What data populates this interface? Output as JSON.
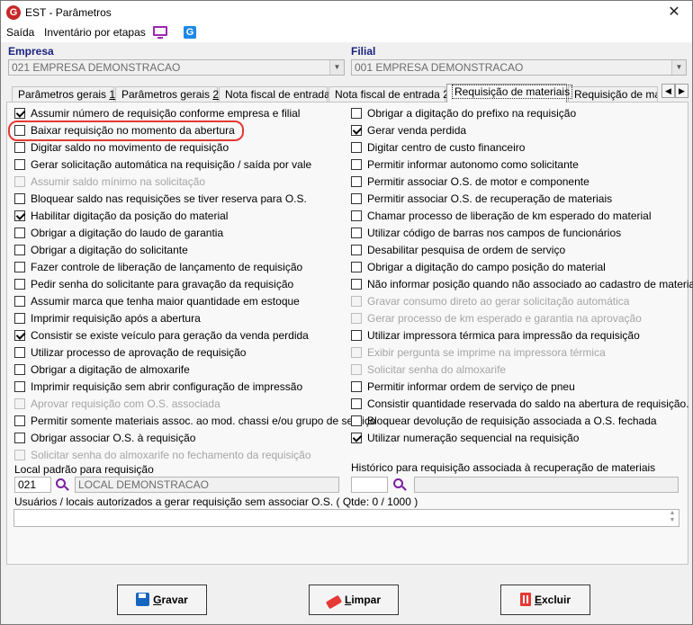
{
  "window": {
    "title": "EST - Parâmetros",
    "app_logo": "G",
    "close": "✕"
  },
  "menu": {
    "items": [
      "Saída",
      "Inventário por etapas"
    ],
    "icon_tv": "monitor-icon",
    "icon_g": "G"
  },
  "empresa": {
    "label": "Empresa",
    "value": "021 EMPRESA DEMONSTRACAO"
  },
  "filial": {
    "label": "Filial",
    "value": "001 EMPRESA DEMONSTRACAO"
  },
  "tabs": [
    {
      "pre": "Parâmetros gerais ",
      "key": "1",
      "post": ""
    },
    {
      "pre": "Parâmetros gerais ",
      "key": "2",
      "post": ""
    },
    {
      "pre": "Nota fiscal de entrada",
      "key": "",
      "post": ""
    },
    {
      "pre": "Nota fiscal de entrada 2",
      "key": "",
      "post": ""
    },
    {
      "pre": "Requisição de materiais",
      "key": "",
      "post": ""
    },
    {
      "pre": "Requisição de materi",
      "key": "",
      "post": ""
    }
  ],
  "left_options": [
    {
      "label": "Assumir número de requisição conforme empresa e filial",
      "checked": true,
      "enabled": true
    },
    {
      "label": "Baixar requisição no momento da abertura",
      "checked": false,
      "enabled": true
    },
    {
      "label": "Digitar saldo no movimento de requisição",
      "checked": false,
      "enabled": true
    },
    {
      "label": "Gerar solicitação automática na requisição / saída por vale",
      "checked": false,
      "enabled": true
    },
    {
      "label": "Assumir saldo mínimo na solicitação",
      "checked": false,
      "enabled": false
    },
    {
      "label": "Bloquear saldo nas requisições se tiver reserva para O.S.",
      "checked": false,
      "enabled": true
    },
    {
      "label": "Habilitar digitação da posição do material",
      "checked": true,
      "enabled": true
    },
    {
      "label": "Obrigar a digitação do laudo de garantia",
      "checked": false,
      "enabled": true
    },
    {
      "label": "Obrigar a digitação do solicitante",
      "checked": false,
      "enabled": true
    },
    {
      "label": "Fazer controle de liberação de lançamento de requisição",
      "checked": false,
      "enabled": true
    },
    {
      "label": "Pedir senha do solicitante para gravação da requisição",
      "checked": false,
      "enabled": true
    },
    {
      "label": "Assumir marca que tenha maior quantidade em estoque",
      "checked": false,
      "enabled": true
    },
    {
      "label": "Imprimir requisição após a abertura",
      "checked": false,
      "enabled": true
    },
    {
      "label": "Consistir se existe veículo para geração da venda perdida",
      "checked": true,
      "enabled": true
    },
    {
      "label": "Utilizar processo de aprovação de requisição",
      "checked": false,
      "enabled": true
    },
    {
      "label": "Obrigar a digitação de almoxarife",
      "checked": false,
      "enabled": true
    },
    {
      "label": "Imprimir requisição sem abrir configuração de impressão",
      "checked": false,
      "enabled": true
    },
    {
      "label": "Aprovar requisição com O.S. associada",
      "checked": false,
      "enabled": false
    },
    {
      "label": "Permitir somente materiais assoc. ao mod. chassi e/ou grupo de serviço",
      "checked": false,
      "enabled": true
    },
    {
      "label": "Obrigar associar O.S. à requisição",
      "checked": false,
      "enabled": true
    },
    {
      "label": "Solicitar senha do almoxarife no fechamento da requisição",
      "checked": false,
      "enabled": false
    }
  ],
  "right_options": [
    {
      "label": "Obrigar a digitação do prefixo na requisição",
      "checked": false,
      "enabled": true
    },
    {
      "label": "Gerar venda perdida",
      "checked": true,
      "enabled": true
    },
    {
      "label": "Digitar centro de custo financeiro",
      "checked": false,
      "enabled": true
    },
    {
      "label": "Permitir informar autonomo como solicitante",
      "checked": false,
      "enabled": true
    },
    {
      "label": "Permitir associar O.S. de motor e componente",
      "checked": false,
      "enabled": true
    },
    {
      "label": "Permitir associar O.S. de recuperação de materiais",
      "checked": false,
      "enabled": true
    },
    {
      "label": "Chamar processo de liberação de km esperado do material",
      "checked": false,
      "enabled": true
    },
    {
      "label": "Utilizar código de barras nos campos de funcionários",
      "checked": false,
      "enabled": true
    },
    {
      "label": "Desabilitar pesquisa de ordem de serviço",
      "checked": false,
      "enabled": true
    },
    {
      "label": "Obrigar a digitação do campo posição do material",
      "checked": false,
      "enabled": true
    },
    {
      "label": "Não informar posição quando não associado ao cadastro de material",
      "checked": false,
      "enabled": true
    },
    {
      "label": "Gravar consumo direto ao gerar solicitação automática",
      "checked": false,
      "enabled": false
    },
    {
      "label": "Gerar processo de km esperado e garantia na aprovação",
      "checked": false,
      "enabled": false
    },
    {
      "label": "Utilizar impressora térmica para impressão da requisição",
      "checked": false,
      "enabled": true
    },
    {
      "label": "Exibir pergunta se imprime na impressora térmica",
      "checked": false,
      "enabled": false
    },
    {
      "label": "Solicitar senha do almoxarife",
      "checked": false,
      "enabled": false
    },
    {
      "label": "Permitir informar ordem de serviço de pneu",
      "checked": false,
      "enabled": true
    },
    {
      "label": "Consistir quantidade reservada do saldo na abertura de requisição.",
      "checked": false,
      "enabled": true
    },
    {
      "label": "Bloquear devolução de requisição associada a O.S. fechada",
      "checked": false,
      "enabled": true
    },
    {
      "label": "Utilizar numeração sequencial na requisição",
      "checked": true,
      "enabled": true
    }
  ],
  "local": {
    "label": "Local padrão para requisição",
    "code": "021",
    "name": "LOCAL DEMONSTRACAO"
  },
  "historico": {
    "label": "Histórico para requisição associada à recuperação de materiais",
    "code": "",
    "name": ""
  },
  "usuarios": {
    "label": "Usuários / locais autorizados a gerar requisição sem associar O.S.  ( Qtde: 0 / 1000 )"
  },
  "buttons": {
    "gravar": {
      "key": "G",
      "rest": "ravar"
    },
    "limpar": {
      "key": "L",
      "rest": "impar"
    },
    "excluir": {
      "key": "E",
      "rest": "xcluir"
    }
  }
}
